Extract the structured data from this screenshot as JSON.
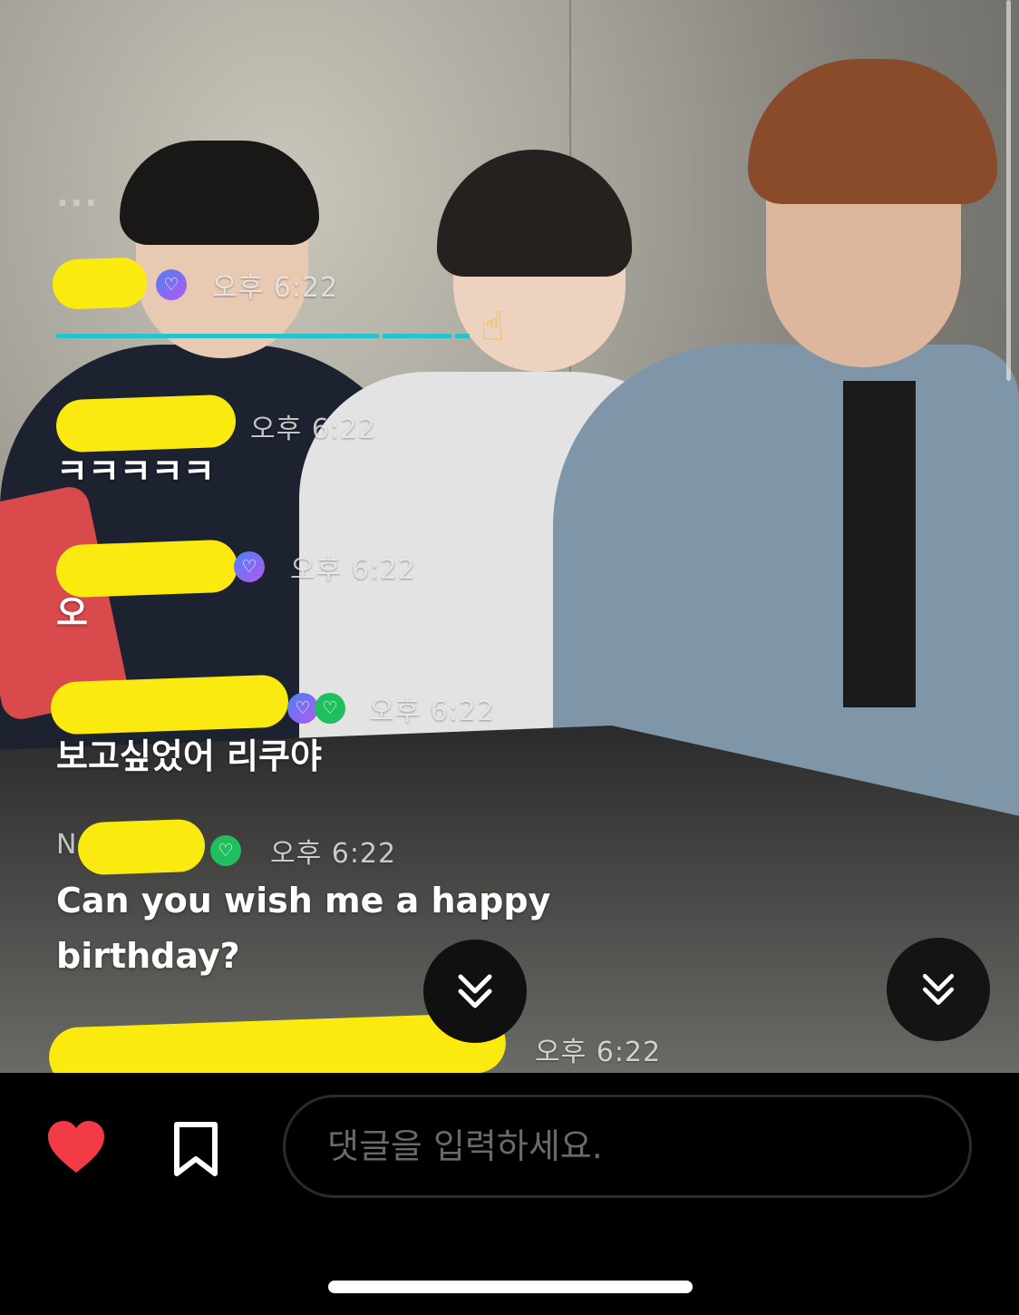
{
  "chat": {
    "faded_message": "...",
    "messages": [
      {
        "name": "",
        "time": "오후 6:22",
        "text": ""
      },
      {
        "name": "",
        "time": "오후 6:22",
        "text": "ㅋㅋㅋㅋㅋ"
      },
      {
        "name": "",
        "time": "오후 6:22",
        "text": "오"
      },
      {
        "name": "",
        "time": "오후 6:22",
        "text": "보고싶었어 리쿠야"
      },
      {
        "name": "N",
        "time": "오후 6:22",
        "text_line1": "Can you wish me a happy",
        "text_line2": "birthday?"
      },
      {
        "name": "",
        "time": "오후 6:22",
        "text": ""
      }
    ]
  },
  "badges": {
    "purple": "♡",
    "green": "♡"
  },
  "icons": {
    "like": "heart-icon",
    "save": "bookmark-icon",
    "scroll": "chevrons-down-icon",
    "pointer": "☝"
  },
  "comment_input": {
    "placeholder": "댓글을 입력하세요.",
    "value": ""
  },
  "colors": {
    "heart": "#f23b45",
    "redaction": "#fbea10",
    "progress": "#25c3cc",
    "badge_green": "#1fbf5e"
  }
}
